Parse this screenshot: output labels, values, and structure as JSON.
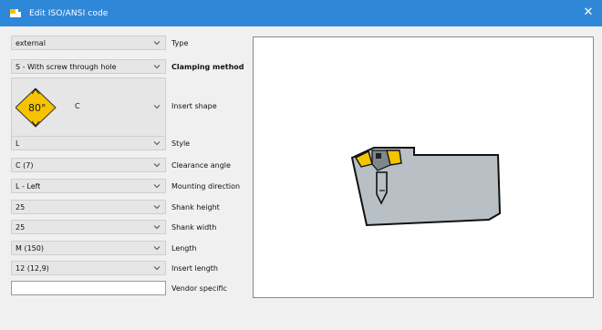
{
  "window": {
    "title": "Edit ISO/ANSI code",
    "close_glyph": "✕",
    "app_icon": "tool-holder-icon"
  },
  "fields": {
    "type": {
      "value": "external",
      "label": "Type"
    },
    "clamping_method": {
      "value": "S - With screw through hole",
      "label": "Clamping method"
    },
    "insert_shape": {
      "code": "C",
      "angle": "80°",
      "label": "Insert shape"
    },
    "style": {
      "value": "L",
      "label": "Style"
    },
    "clearance_angle": {
      "value": "C  (7)",
      "label": "Clearance angle"
    },
    "mounting_direction": {
      "value": "L - Left",
      "label": "Mounting direction"
    },
    "shank_height": {
      "value": "25",
      "label": "Shank height"
    },
    "shank_width": {
      "value": "25",
      "label": "Shank width"
    },
    "length": {
      "value": "M  (150)",
      "label": "Length"
    },
    "insert_length": {
      "value": "12  (12,9)",
      "label": "Insert length"
    },
    "vendor_specific": {
      "value": "",
      "label": "Vendor specific"
    }
  },
  "colors": {
    "titlebar": "#2f87d8",
    "insert_yellow": "#f5c400",
    "holder_gray": "#b8c0c6"
  }
}
